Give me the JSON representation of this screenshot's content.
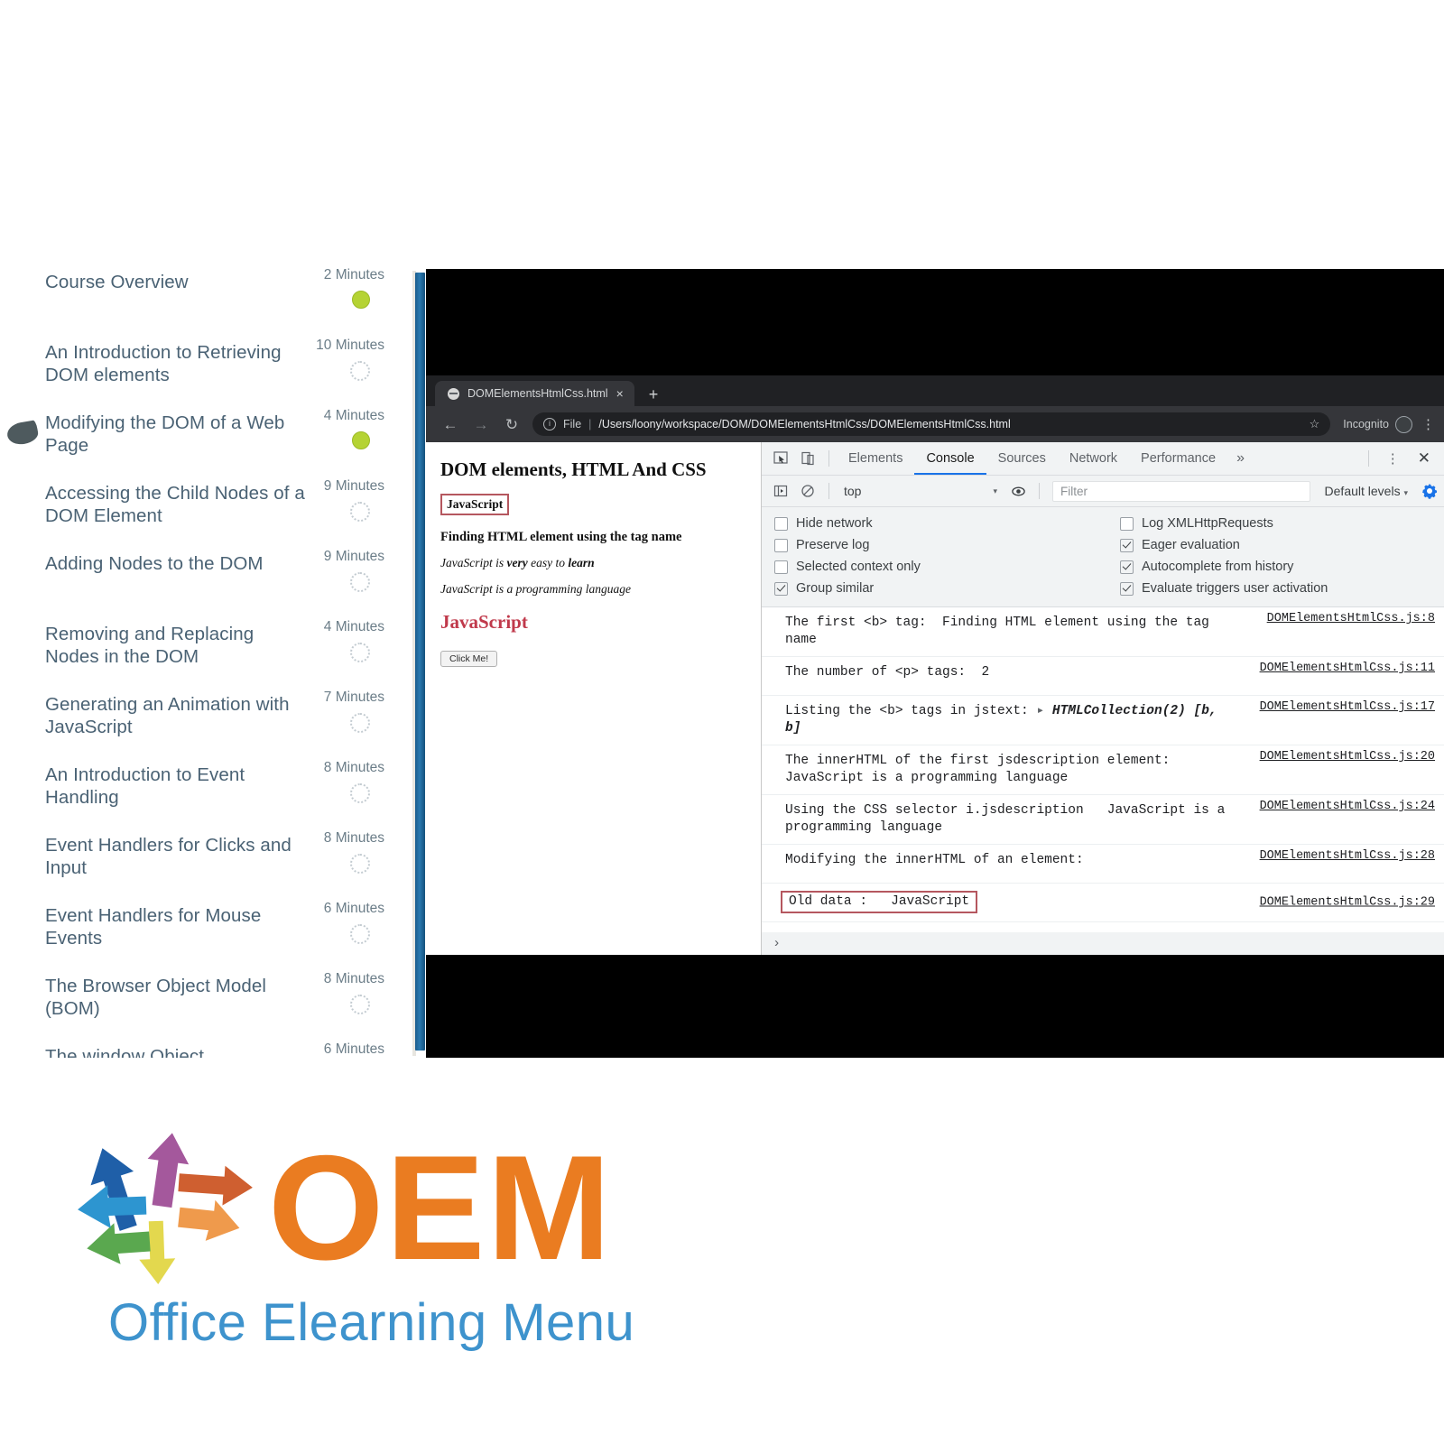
{
  "course_list": {
    "lessons": [
      {
        "title": "Course Overview",
        "duration": "2 Minutes",
        "status": "done"
      },
      {
        "title": "An Introduction to Retrieving DOM elements",
        "duration": "10 Minutes",
        "status": "pending"
      },
      {
        "title": "Modifying the DOM of a Web Page",
        "duration": "4 Minutes",
        "status": "done"
      },
      {
        "title": "Accessing the Child Nodes of a DOM Element",
        "duration": "9 Minutes",
        "status": "pending"
      },
      {
        "title": "Adding Nodes to the DOM",
        "duration": "9 Minutes",
        "status": "pending"
      },
      {
        "title": "Removing and Replacing Nodes in the DOM",
        "duration": "4 Minutes",
        "status": "pending"
      },
      {
        "title": "Generating an Animation with JavaScript",
        "duration": "7 Minutes",
        "status": "pending"
      },
      {
        "title": "An Introduction to Event Handling",
        "duration": "8 Minutes",
        "status": "pending"
      },
      {
        "title": "Event Handlers for Clicks and Input",
        "duration": "8 Minutes",
        "status": "pending"
      },
      {
        "title": "Event Handlers for Mouse Events",
        "duration": "6 Minutes",
        "status": "pending"
      },
      {
        "title": "The Browser Object Model (BOM)",
        "duration": "8 Minutes",
        "status": "pending"
      },
      {
        "title": "The window Object",
        "duration": "6 Minutes",
        "status": "pending"
      }
    ]
  },
  "browser": {
    "tab": {
      "title": "DOMElementsHtmlCss.html",
      "close_label": "×",
      "favicon": "globe-icon"
    },
    "new_tab_label": "+",
    "nav": {
      "back": "←",
      "forward": "→",
      "reload": "↻"
    },
    "omnibox": {
      "info_glyph": "i",
      "scheme_label": "File",
      "separator": "|",
      "url": "/Users/loony/workspace/DOM/DOMElementsHtmlCss/DOMElementsHtmlCss.html",
      "star": "☆"
    },
    "incognito_label": "Incognito",
    "menu_glyph": "⋮"
  },
  "page": {
    "h1": "DOM elements, HTML And CSS",
    "highlighted_bold": "JavaScript",
    "bold_line": "Finding HTML element using the tag name",
    "italic_1_pre": "JavaScript is ",
    "italic_1_bold1": "very",
    "italic_1_mid": " easy to ",
    "italic_1_bold2": "learn",
    "italic_2": "JavaScript is a programming language",
    "red_heading": "JavaScript",
    "button_label": "Click Me!"
  },
  "devtools": {
    "icons": {
      "inspect": "inspect-element-icon",
      "device": "device-toolbar-icon"
    },
    "tabs": [
      {
        "label": "Elements",
        "active": false
      },
      {
        "label": "Console",
        "active": true
      },
      {
        "label": "Sources",
        "active": false
      },
      {
        "label": "Network",
        "active": false
      },
      {
        "label": "Performance",
        "active": false
      }
    ],
    "more_tabs_glyph": "»",
    "kebab_glyph": "⋮",
    "close_glyph": "✕",
    "filterbar": {
      "sidebar_toggle": "console-sidebar-icon",
      "clear_glyph": "⊘",
      "context": "top",
      "caret": "▾",
      "eye_icon": "live-expression-icon",
      "filter_placeholder": "Filter",
      "levels": "Default levels",
      "levels_caret": "▾",
      "settings_icon": "gear-icon"
    },
    "settings": [
      {
        "label": "Hide network",
        "checked": false
      },
      {
        "label": "Log XMLHttpRequests",
        "checked": false
      },
      {
        "label": "Preserve log",
        "checked": false
      },
      {
        "label": "Eager evaluation",
        "checked": true
      },
      {
        "label": "Selected context only",
        "checked": false
      },
      {
        "label": "Autocomplete from history",
        "checked": true
      },
      {
        "label": "Group similar",
        "checked": true
      },
      {
        "label": "Evaluate triggers user activation",
        "checked": true
      }
    ],
    "console_rows": [
      {
        "text": "The first <b> tag:  Finding HTML element using the tag name",
        "source": "DOMElementsHtmlCss.js:8",
        "source_pos": "top",
        "highlight": false
      },
      {
        "text": "The number of <p> tags:  2",
        "source": "DOMElementsHtmlCss.js:11",
        "source_pos": "top",
        "highlight": false
      },
      {
        "text": "Listing the <b> tags in jstext: ▸ HTMLCollection(2) [b, b]",
        "source": "DOMElementsHtmlCss.js:17",
        "source_pos": "top",
        "highlight": false
      },
      {
        "text": "The innerHTML of the first jsdescription element:   JavaScript is a programming language",
        "source": "DOMElementsHtmlCss.js:20",
        "source_pos": "top",
        "highlight": false
      },
      {
        "text": "Using the CSS selector i.jsdescription   JavaScript is a programming language",
        "source": "DOMElementsHtmlCss.js:24",
        "source_pos": "top",
        "highlight": false
      },
      {
        "text": "Modifying the innerHTML of an element:",
        "source": "DOMElementsHtmlCss.js:28",
        "source_pos": "top",
        "highlight": false
      },
      {
        "text": "Old data :   JavaScript",
        "source": "DOMElementsHtmlCss.js:29",
        "source_pos": "mid",
        "highlight": true
      }
    ],
    "prompt_glyph": "›"
  },
  "brand": {
    "title": "OEM",
    "subtitle": "Office Elearning Menu",
    "colors": {
      "orange": "#ea7c21",
      "blue": "#3e93cd"
    }
  },
  "colors": {
    "status_done": "#b5d334",
    "accent_blue": "#1a73e8",
    "highlight_red": "#b5575f"
  }
}
